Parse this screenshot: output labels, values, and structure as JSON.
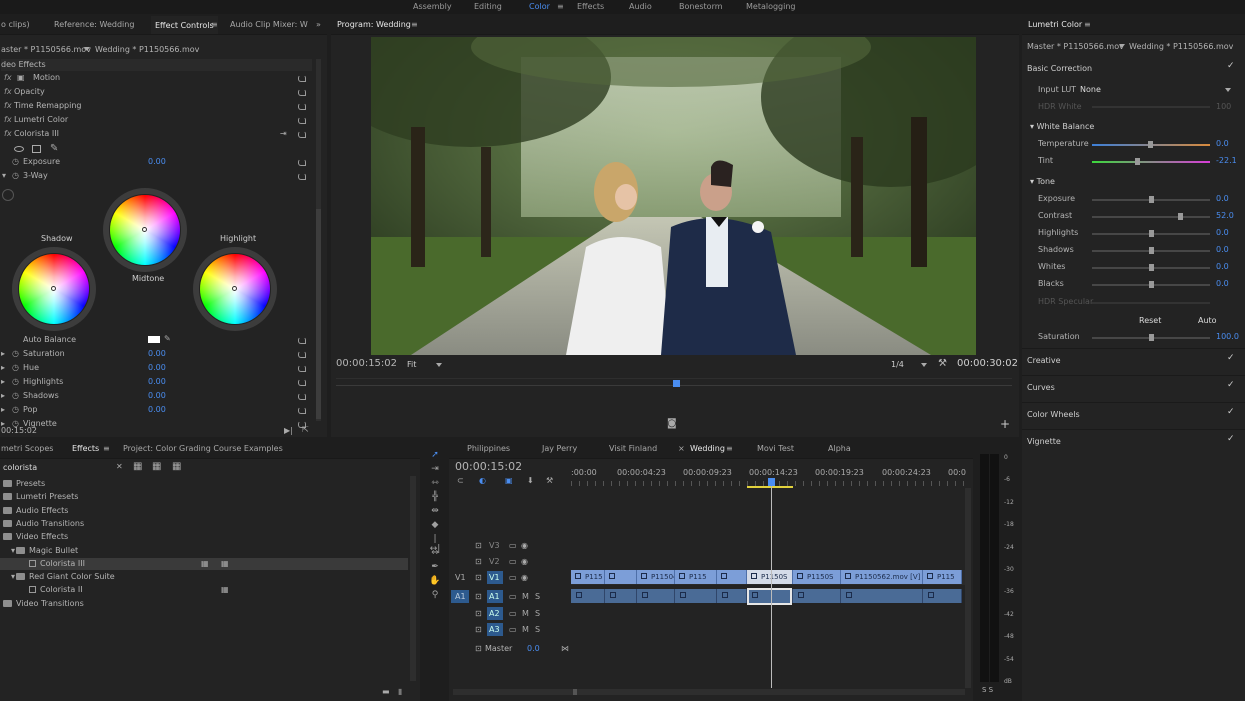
{
  "workspace": {
    "tabs": [
      "Assembly",
      "Editing",
      "Color",
      "Effects",
      "Audio",
      "Bonestorm",
      "Metalogging"
    ],
    "active": "Color"
  },
  "topleft": {
    "tabs": [
      {
        "label": "o clips)"
      },
      {
        "label": "Reference: Wedding"
      },
      {
        "label": "Effect Controls",
        "active": true
      },
      {
        "label": "Audio Clip Mixer: W"
      }
    ]
  },
  "effect_controls": {
    "master": "aster * P1150566.mov",
    "clip": "Wedding * P1150566.mov",
    "section": "deo Effects",
    "rows": [
      {
        "label": "Motion",
        "fx": true
      },
      {
        "label": "Opacity",
        "fx": true
      },
      {
        "label": "Time Remapping",
        "fx": true
      },
      {
        "label": "Lumetri Color",
        "fx": true
      },
      {
        "label": "Colorista III",
        "fx": true
      }
    ],
    "exposure_label": "Exposure",
    "exposure_value": "0.00",
    "threeway": "3-Way",
    "wheels": {
      "shadow": "Shadow",
      "midtone": "Midtone",
      "highlight": "Highlight"
    },
    "auto_balance": "Auto Balance",
    "params": [
      {
        "label": "Saturation",
        "value": "0.00"
      },
      {
        "label": "Hue",
        "value": "0.00"
      },
      {
        "label": "Highlights",
        "value": "0.00"
      },
      {
        "label": "Shadows",
        "value": "0.00"
      },
      {
        "label": "Pop",
        "value": "0.00"
      },
      {
        "label": "Vignette",
        "value": ""
      }
    ],
    "timecode": "00:15:02"
  },
  "program": {
    "title": "Program: Wedding",
    "timecode": "00:00:15:02",
    "fit": "Fit",
    "quality": "1/4",
    "duration": "00:00:30:02"
  },
  "lumetri": {
    "title": "Lumetri Color",
    "master": "Master * P1150566.mov",
    "clip": "Wedding * P1150566.mov",
    "basic": "Basic Correction",
    "input_lut_label": "Input LUT",
    "input_lut_value": "None",
    "hdr_white": "HDR White",
    "hdr_white_value": "100",
    "wb": "White Balance",
    "temp_label": "Temperature",
    "temp_value": "0.0",
    "tint_label": "Tint",
    "tint_value": "-22.1",
    "tone": "Tone",
    "tone_rows": [
      {
        "label": "Exposure",
        "value": "0.0",
        "pos": 0.5
      },
      {
        "label": "Contrast",
        "value": "52.0",
        "pos": 0.76
      },
      {
        "label": "Highlights",
        "value": "0.0",
        "pos": 0.5
      },
      {
        "label": "Shadows",
        "value": "0.0",
        "pos": 0.5
      },
      {
        "label": "Whites",
        "value": "0.0",
        "pos": 0.5
      },
      {
        "label": "Blacks",
        "value": "0.0",
        "pos": 0.5
      }
    ],
    "hdr_specular": "HDR Specular",
    "reset": "Reset",
    "auto": "Auto",
    "sat_label": "Saturation",
    "sat_value": "100.0",
    "sections": [
      "Creative",
      "Curves",
      "Color Wheels",
      "Vignette"
    ]
  },
  "effects_panel": {
    "tabs": [
      {
        "label": "metri Scopes"
      },
      {
        "label": "Effects",
        "active": true
      },
      {
        "label": "Project: Color Grading Course Examples"
      }
    ],
    "search": "colorista",
    "tree": [
      {
        "label": "Presets",
        "indent": 0
      },
      {
        "label": "Lumetri Presets",
        "indent": 0
      },
      {
        "label": "Audio Effects",
        "indent": 0
      },
      {
        "label": "Audio Transitions",
        "indent": 0
      },
      {
        "label": "Video Effects",
        "indent": 0
      },
      {
        "label": "Magic Bullet",
        "indent": 1
      },
      {
        "label": "Colorista III",
        "indent": 2,
        "selected": true
      },
      {
        "label": "Red Giant Color Suite",
        "indent": 1
      },
      {
        "label": "Colorista II",
        "indent": 2
      },
      {
        "label": "Video Transitions",
        "indent": 0
      }
    ]
  },
  "timeline": {
    "tabs": [
      {
        "label": "Philippines"
      },
      {
        "label": "Jay Perry"
      },
      {
        "label": "Visit Finland"
      },
      {
        "label": "Wedding",
        "active": true
      },
      {
        "label": "Movi Test"
      },
      {
        "label": "Alpha"
      }
    ],
    "timecode": "00:00:15:02",
    "ruler": [
      ":00:00",
      "00:00:04:23",
      "00:00:09:23",
      "00:00:14:23",
      "00:00:19:23",
      "00:00:24:23",
      "00:0"
    ],
    "tracks": [
      "V3",
      "V2",
      "V1",
      "A1",
      "A2",
      "A3"
    ],
    "clips": [
      "P115",
      "P115047",
      "P115",
      "P1150S",
      "P1150S",
      "P1150562.mov [V]",
      "P115"
    ],
    "master_label": "Master",
    "master_value": "0.0"
  },
  "meter": {
    "scale": [
      "0",
      "-6",
      "-12",
      "-18",
      "-24",
      "-30",
      "-36",
      "-42",
      "-48",
      "-54",
      "dB"
    ],
    "bottom": "S  S"
  },
  "colors": {
    "accent": "#4a8df0",
    "bg": "#232323",
    "clip": "#7c9ed8"
  }
}
